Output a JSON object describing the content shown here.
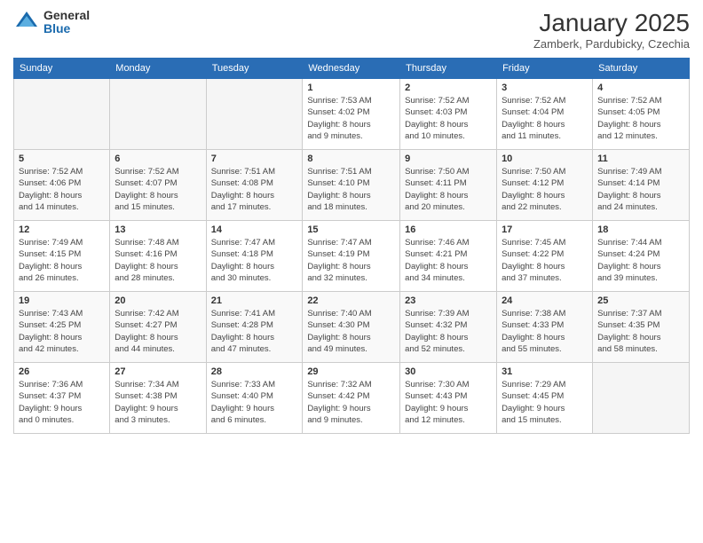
{
  "logo": {
    "general": "General",
    "blue": "Blue"
  },
  "header": {
    "month": "January 2025",
    "location": "Zamberk, Pardubicky, Czechia"
  },
  "weekdays": [
    "Sunday",
    "Monday",
    "Tuesday",
    "Wednesday",
    "Thursday",
    "Friday",
    "Saturday"
  ],
  "weeks": [
    [
      {
        "day": "",
        "info": ""
      },
      {
        "day": "",
        "info": ""
      },
      {
        "day": "",
        "info": ""
      },
      {
        "day": "1",
        "info": "Sunrise: 7:53 AM\nSunset: 4:02 PM\nDaylight: 8 hours\nand 9 minutes."
      },
      {
        "day": "2",
        "info": "Sunrise: 7:52 AM\nSunset: 4:03 PM\nDaylight: 8 hours\nand 10 minutes."
      },
      {
        "day": "3",
        "info": "Sunrise: 7:52 AM\nSunset: 4:04 PM\nDaylight: 8 hours\nand 11 minutes."
      },
      {
        "day": "4",
        "info": "Sunrise: 7:52 AM\nSunset: 4:05 PM\nDaylight: 8 hours\nand 12 minutes."
      }
    ],
    [
      {
        "day": "5",
        "info": "Sunrise: 7:52 AM\nSunset: 4:06 PM\nDaylight: 8 hours\nand 14 minutes."
      },
      {
        "day": "6",
        "info": "Sunrise: 7:52 AM\nSunset: 4:07 PM\nDaylight: 8 hours\nand 15 minutes."
      },
      {
        "day": "7",
        "info": "Sunrise: 7:51 AM\nSunset: 4:08 PM\nDaylight: 8 hours\nand 17 minutes."
      },
      {
        "day": "8",
        "info": "Sunrise: 7:51 AM\nSunset: 4:10 PM\nDaylight: 8 hours\nand 18 minutes."
      },
      {
        "day": "9",
        "info": "Sunrise: 7:50 AM\nSunset: 4:11 PM\nDaylight: 8 hours\nand 20 minutes."
      },
      {
        "day": "10",
        "info": "Sunrise: 7:50 AM\nSunset: 4:12 PM\nDaylight: 8 hours\nand 22 minutes."
      },
      {
        "day": "11",
        "info": "Sunrise: 7:49 AM\nSunset: 4:14 PM\nDaylight: 8 hours\nand 24 minutes."
      }
    ],
    [
      {
        "day": "12",
        "info": "Sunrise: 7:49 AM\nSunset: 4:15 PM\nDaylight: 8 hours\nand 26 minutes."
      },
      {
        "day": "13",
        "info": "Sunrise: 7:48 AM\nSunset: 4:16 PM\nDaylight: 8 hours\nand 28 minutes."
      },
      {
        "day": "14",
        "info": "Sunrise: 7:47 AM\nSunset: 4:18 PM\nDaylight: 8 hours\nand 30 minutes."
      },
      {
        "day": "15",
        "info": "Sunrise: 7:47 AM\nSunset: 4:19 PM\nDaylight: 8 hours\nand 32 minutes."
      },
      {
        "day": "16",
        "info": "Sunrise: 7:46 AM\nSunset: 4:21 PM\nDaylight: 8 hours\nand 34 minutes."
      },
      {
        "day": "17",
        "info": "Sunrise: 7:45 AM\nSunset: 4:22 PM\nDaylight: 8 hours\nand 37 minutes."
      },
      {
        "day": "18",
        "info": "Sunrise: 7:44 AM\nSunset: 4:24 PM\nDaylight: 8 hours\nand 39 minutes."
      }
    ],
    [
      {
        "day": "19",
        "info": "Sunrise: 7:43 AM\nSunset: 4:25 PM\nDaylight: 8 hours\nand 42 minutes."
      },
      {
        "day": "20",
        "info": "Sunrise: 7:42 AM\nSunset: 4:27 PM\nDaylight: 8 hours\nand 44 minutes."
      },
      {
        "day": "21",
        "info": "Sunrise: 7:41 AM\nSunset: 4:28 PM\nDaylight: 8 hours\nand 47 minutes."
      },
      {
        "day": "22",
        "info": "Sunrise: 7:40 AM\nSunset: 4:30 PM\nDaylight: 8 hours\nand 49 minutes."
      },
      {
        "day": "23",
        "info": "Sunrise: 7:39 AM\nSunset: 4:32 PM\nDaylight: 8 hours\nand 52 minutes."
      },
      {
        "day": "24",
        "info": "Sunrise: 7:38 AM\nSunset: 4:33 PM\nDaylight: 8 hours\nand 55 minutes."
      },
      {
        "day": "25",
        "info": "Sunrise: 7:37 AM\nSunset: 4:35 PM\nDaylight: 8 hours\nand 58 minutes."
      }
    ],
    [
      {
        "day": "26",
        "info": "Sunrise: 7:36 AM\nSunset: 4:37 PM\nDaylight: 9 hours\nand 0 minutes."
      },
      {
        "day": "27",
        "info": "Sunrise: 7:34 AM\nSunset: 4:38 PM\nDaylight: 9 hours\nand 3 minutes."
      },
      {
        "day": "28",
        "info": "Sunrise: 7:33 AM\nSunset: 4:40 PM\nDaylight: 9 hours\nand 6 minutes."
      },
      {
        "day": "29",
        "info": "Sunrise: 7:32 AM\nSunset: 4:42 PM\nDaylight: 9 hours\nand 9 minutes."
      },
      {
        "day": "30",
        "info": "Sunrise: 7:30 AM\nSunset: 4:43 PM\nDaylight: 9 hours\nand 12 minutes."
      },
      {
        "day": "31",
        "info": "Sunrise: 7:29 AM\nSunset: 4:45 PM\nDaylight: 9 hours\nand 15 minutes."
      },
      {
        "day": "",
        "info": ""
      }
    ]
  ]
}
